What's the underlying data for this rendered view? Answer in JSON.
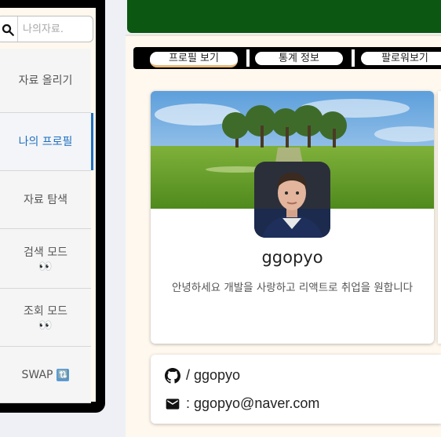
{
  "sidebar": {
    "search": {
      "placeholder": "나의자료.",
      "value": ""
    },
    "items": [
      {
        "label": "자료 올리기"
      },
      {
        "label": "나의 프로필",
        "active": true
      },
      {
        "label": "자료 탐색"
      },
      {
        "label": "검색 모드",
        "icon": "👀"
      },
      {
        "label": "조회 모드",
        "icon": "👀"
      },
      {
        "label": "SWAP",
        "icon": "🔃"
      }
    ]
  },
  "header": {
    "color": "#0c5711"
  },
  "tabs": [
    {
      "label": "프로필 보기",
      "selected": true
    },
    {
      "label": "통계 정보"
    },
    {
      "label": "팔로워보기"
    }
  ],
  "profile": {
    "username": "ggopyo",
    "bio": "안녕하세요 개발을 사랑하고 리액트로 취업을 원합니다"
  },
  "contact": {
    "github": "/ ggopyo",
    "email": ": ggopyo@naver.com"
  },
  "colors": {
    "accent": "#1f6fbf",
    "tab_underline": "#e6b877",
    "panel": "#fff8ee"
  }
}
